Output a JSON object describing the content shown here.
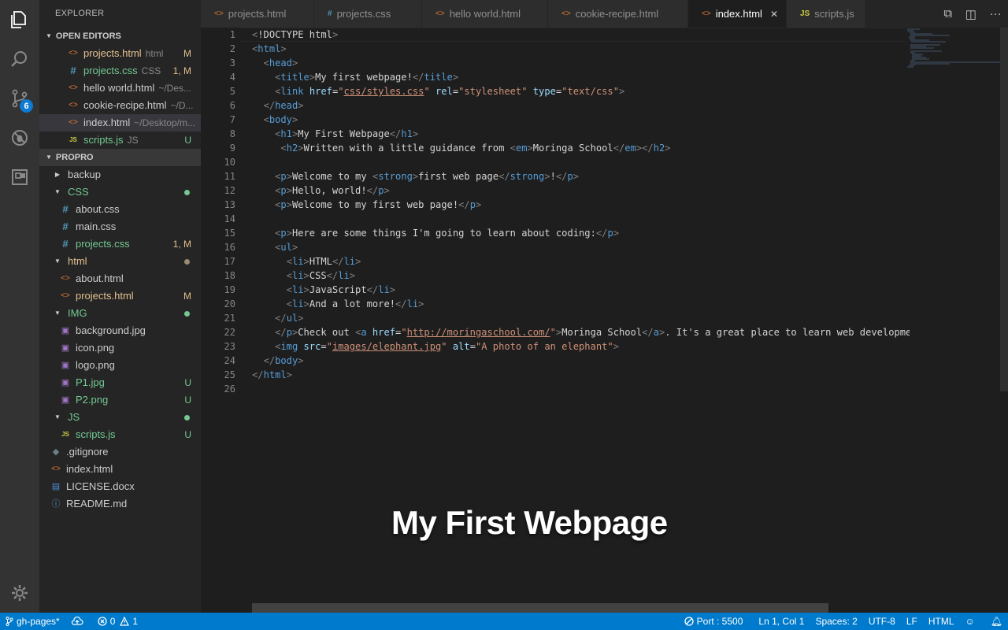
{
  "activity_bar": {
    "scm_badge": "6",
    "icons": [
      "explorer-icon",
      "search-icon",
      "source-control-icon",
      "debug-icon",
      "extensions-icon",
      "settings-gear-icon"
    ]
  },
  "sidebar": {
    "title": "EXPLORER",
    "open_editors": {
      "label": "OPEN EDITORS",
      "items": [
        {
          "name": "projects.html",
          "desc": "html",
          "status": "M",
          "icon": "html-file-icon"
        },
        {
          "name": "projects.css",
          "desc": "CSS",
          "status": "1, M",
          "icon": "css-file-icon"
        },
        {
          "name": "hello world.html",
          "desc": "~/Des...",
          "status": "",
          "icon": "html-file-icon"
        },
        {
          "name": "cookie-recipe.html",
          "desc": "~/D...",
          "status": "",
          "icon": "html-file-icon"
        },
        {
          "name": "index.html",
          "desc": "~/Desktop/m...",
          "status": "",
          "icon": "html-file-icon"
        },
        {
          "name": "scripts.js",
          "desc": "JS",
          "status": "U",
          "icon": "js-file-icon"
        }
      ]
    },
    "project": {
      "label": "PROPRO",
      "tree": [
        {
          "name": "backup",
          "type": "folder-collapsed"
        },
        {
          "name": "CSS",
          "type": "folder-open"
        },
        {
          "name": "about.css",
          "type": "css"
        },
        {
          "name": "main.css",
          "type": "css"
        },
        {
          "name": "projects.css",
          "type": "css",
          "status": "1, M"
        },
        {
          "name": "html",
          "type": "folder-open"
        },
        {
          "name": "about.html",
          "type": "html"
        },
        {
          "name": "projects.html",
          "type": "html",
          "status": "M"
        },
        {
          "name": "IMG",
          "type": "folder-open"
        },
        {
          "name": "background.jpg",
          "type": "img"
        },
        {
          "name": "icon.png",
          "type": "img"
        },
        {
          "name": "logo.png",
          "type": "img"
        },
        {
          "name": "P1.jpg",
          "type": "img",
          "status": "U"
        },
        {
          "name": "P2.png",
          "type": "img",
          "status": "U"
        },
        {
          "name": "JS",
          "type": "folder-open"
        },
        {
          "name": "scripts.js",
          "type": "js",
          "status": "U"
        },
        {
          "name": ".gitignore",
          "type": "git"
        },
        {
          "name": "index.html",
          "type": "html"
        },
        {
          "name": "LICENSE.docx",
          "type": "doc"
        },
        {
          "name": "README.md",
          "type": "info"
        }
      ]
    }
  },
  "tabs": [
    {
      "label": "projects.html",
      "icon": "html-file-icon"
    },
    {
      "label": "projects.css",
      "icon": "css-file-icon"
    },
    {
      "label": "hello world.html",
      "icon": "html-file-icon"
    },
    {
      "label": "cookie-recipe.html",
      "icon": "html-file-icon"
    },
    {
      "label": "index.html",
      "icon": "html-file-icon",
      "active": true,
      "close": "✕"
    },
    {
      "label": "scripts.js",
      "icon": "js-file-icon"
    }
  ],
  "editor": {
    "line_numbers": [
      "1",
      "2",
      "3",
      "4",
      "5",
      "6",
      "7",
      "8",
      "9",
      "10",
      "11",
      "12",
      "13",
      "14",
      "15",
      "16",
      "17",
      "18",
      "19",
      "20",
      "21",
      "22",
      "23",
      "24",
      "25",
      "26"
    ],
    "preview_heading": "My First Webpage"
  },
  "status_bar": {
    "branch": "gh-pages*",
    "errors": "0",
    "warnings": "1",
    "port": "Port : 5500",
    "position": "Ln 1, Col 1",
    "spaces": "Spaces: 2",
    "encoding": "UTF-8",
    "eol": "LF",
    "language": "HTML"
  },
  "colors": {
    "activity_bar": "#333333",
    "sidebar": "#252526",
    "editor": "#1e1e1e",
    "status_bar": "#007acc",
    "modified": "#e2c08d",
    "untracked": "#73c991"
  }
}
